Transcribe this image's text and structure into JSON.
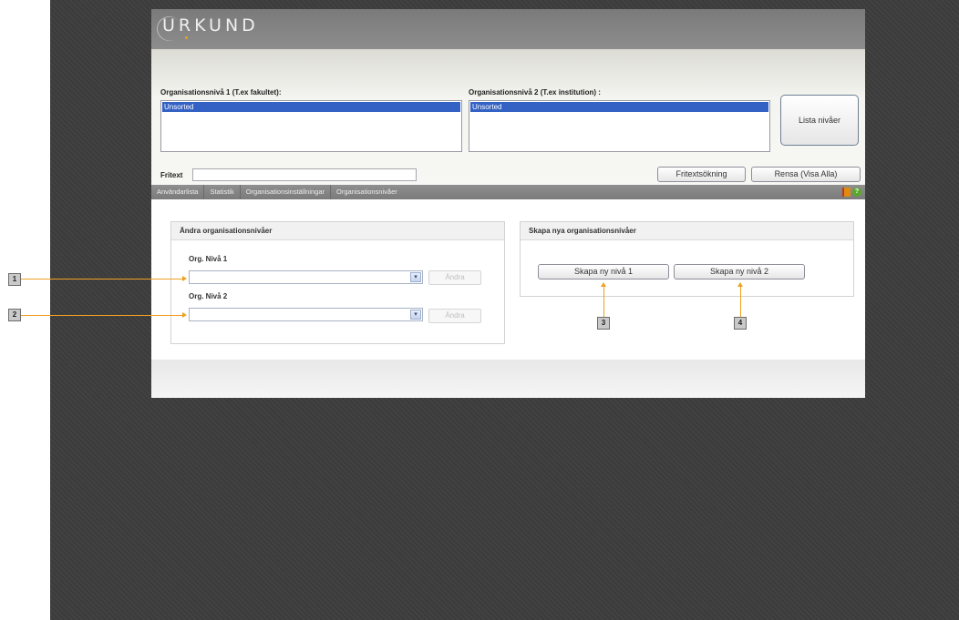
{
  "app": {
    "logo_text": "URKUND"
  },
  "filter": {
    "level1_label": "Organisationsnivå 1 (T.ex fakultet):",
    "level1_selected": "Unsorted",
    "level2_label": "Organisationsnivå 2 (T.ex institution) :",
    "level2_selected": "Unsorted",
    "list_levels_button": "Lista nivåer",
    "fritext_label": "Fritext",
    "fritext_value": "",
    "fritext_search_button": "Fritextsökning",
    "clear_button": "Rensa (Visa Alla)"
  },
  "tabs": [
    {
      "label": "Användarlista"
    },
    {
      "label": "Statistik"
    },
    {
      "label": "Organisationsinställningar"
    },
    {
      "label": "Organisationsnivåer"
    }
  ],
  "icons": {
    "book": "book-icon",
    "help": "help-icon"
  },
  "edit_panel": {
    "title": "Ändra organisationsnivåer",
    "level1_label": "Org. Nivå 1",
    "level1_value": "",
    "level1_button": "Ändra",
    "level2_label": "Org. Nivå 2",
    "level2_value": "",
    "level2_button": "Ändra"
  },
  "create_panel": {
    "title": "Skapa nya organisationsnivåer",
    "create_level1_button": "Skapa ny nivå 1",
    "create_level2_button": "Skapa ny nivå 2"
  },
  "callouts": [
    "1",
    "2",
    "3",
    "4"
  ],
  "colors": {
    "selection": "#3461c4",
    "annotation_line": "#f0a020",
    "background": "#3b3b3b"
  }
}
